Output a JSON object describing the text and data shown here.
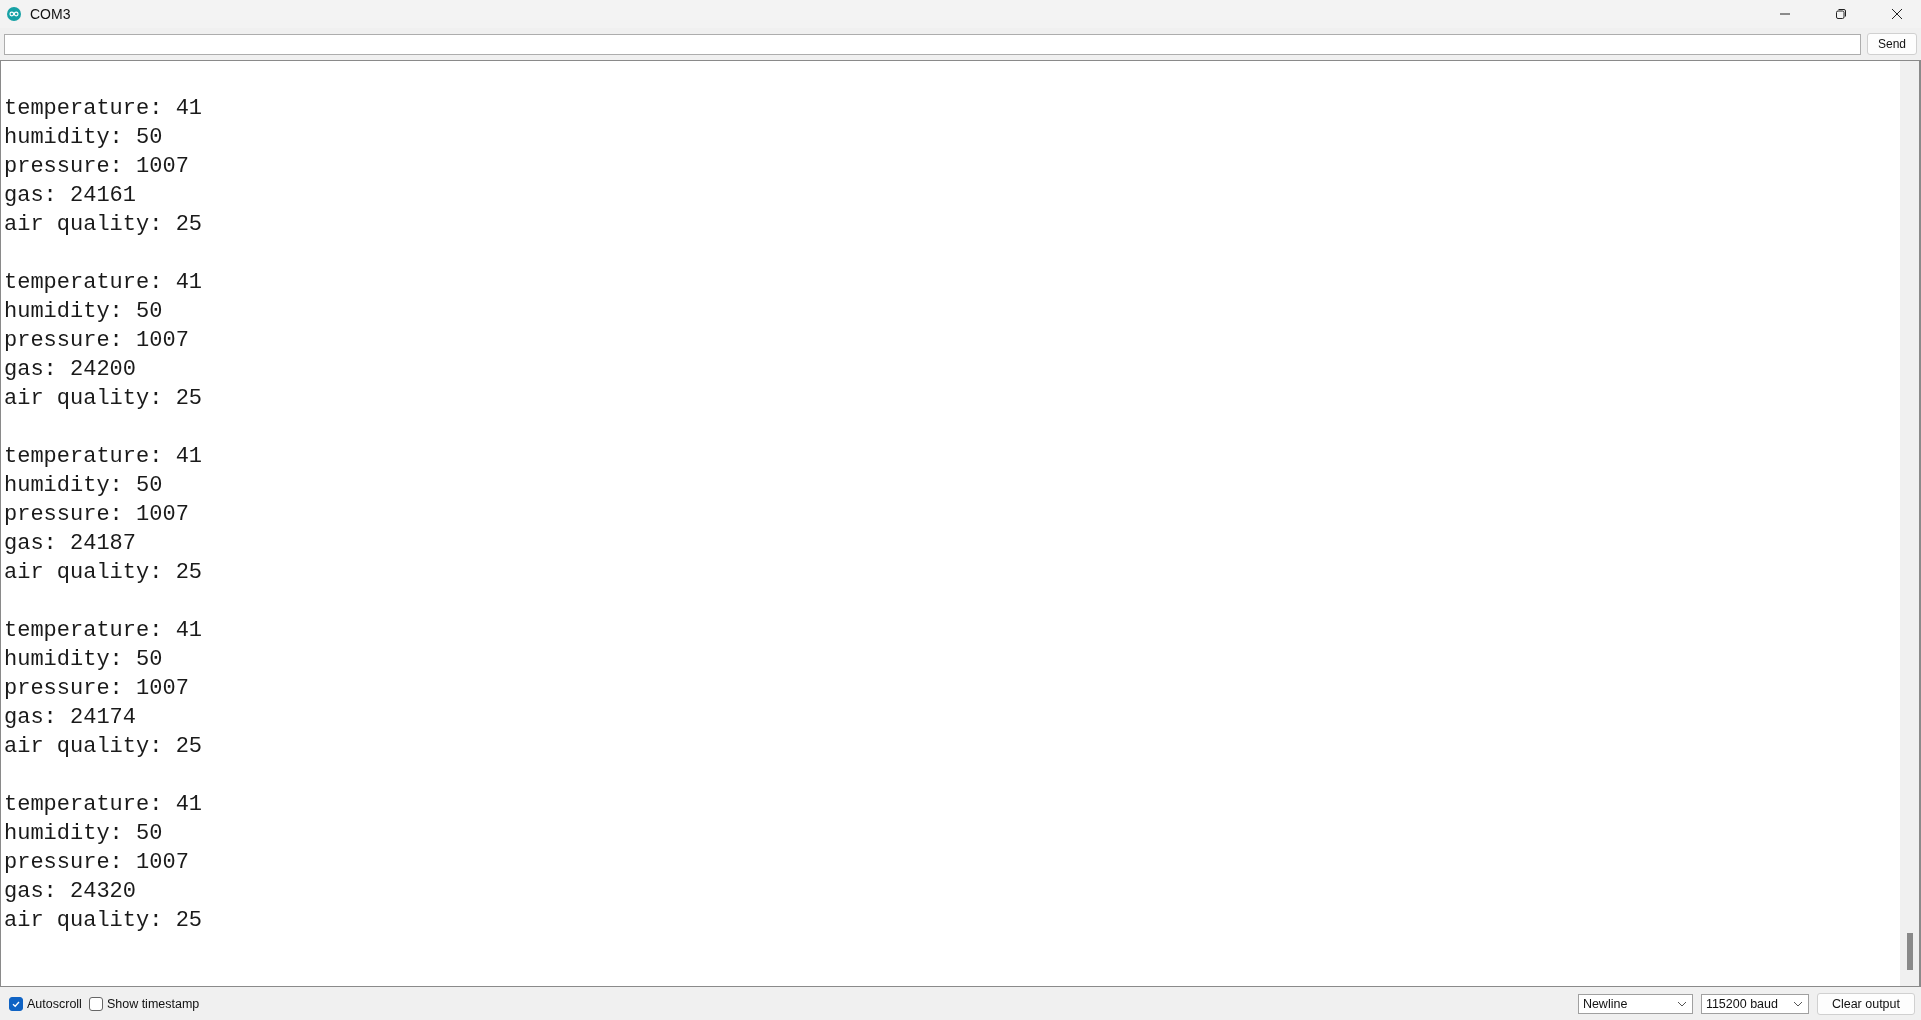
{
  "window": {
    "title": "COM3"
  },
  "send_bar": {
    "button": "Send"
  },
  "output": {
    "groups": [
      {
        "lines": [
          "temperature: 41",
          "humidity: 50",
          "pressure: 1007",
          "gas: 24161",
          "air quality: 25"
        ]
      },
      {
        "lines": [
          "temperature: 41",
          "humidity: 50",
          "pressure: 1007",
          "gas: 24200",
          "air quality: 25"
        ]
      },
      {
        "lines": [
          "temperature: 41",
          "humidity: 50",
          "pressure: 1007",
          "gas: 24187",
          "air quality: 25"
        ]
      },
      {
        "lines": [
          "temperature: 41",
          "humidity: 50",
          "pressure: 1007",
          "gas: 24174",
          "air quality: 25"
        ]
      },
      {
        "lines": [
          "temperature: 41",
          "humidity: 50",
          "pressure: 1007",
          "gas: 24320",
          "air quality: 25"
        ]
      }
    ]
  },
  "status_bar": {
    "checkboxes": [
      {
        "label": "Autoscroll",
        "checked": true
      },
      {
        "label": "Show timestamp",
        "checked": false
      }
    ],
    "dropdowns": [
      {
        "value": "Newline"
      },
      {
        "value": "115200 baud"
      }
    ],
    "button": "Clear output"
  }
}
